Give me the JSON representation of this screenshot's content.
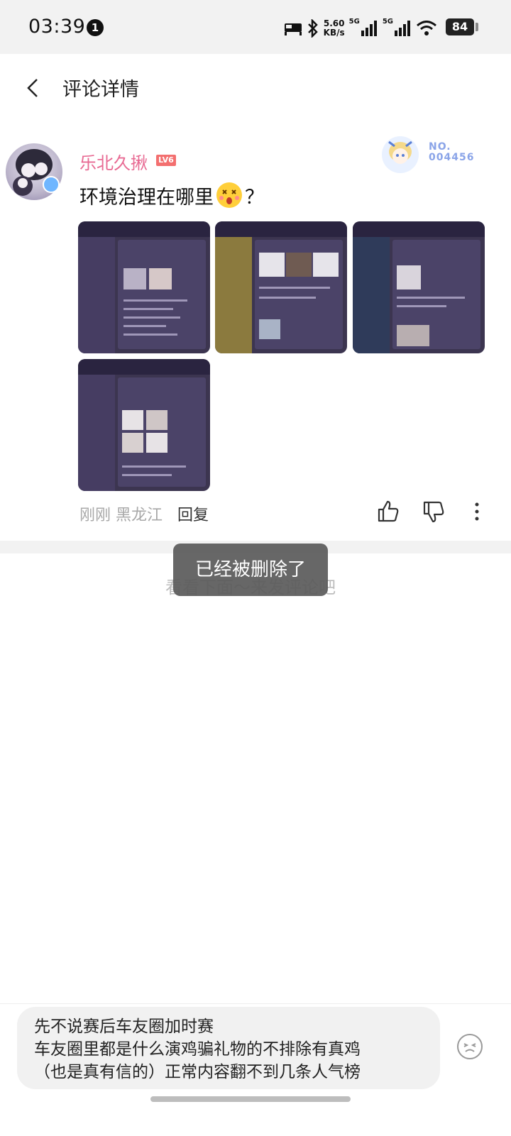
{
  "status_bar": {
    "time": "03:39",
    "notification_count": "1",
    "net_speed": "5.60\nKB/s",
    "sim1": "5G",
    "sim2": "5G",
    "battery": "84"
  },
  "header": {
    "title": "评论详情"
  },
  "comment": {
    "username": "乐北久揪",
    "level": "LV6",
    "number_badge": "NO.\n004456",
    "text_before_emoji": "环境治理在哪里",
    "text_after_emoji": "？",
    "time": "刚刚",
    "location": "黑龙江",
    "reply_label": "回复",
    "images": [
      "screenshot-1",
      "screenshot-2",
      "screenshot-3",
      "screenshot-4"
    ]
  },
  "empty_hint": "看看下面～来发评论吧",
  "toast": "已经被删除了",
  "reply_input": {
    "value": "先不说赛后车友圈加时赛\n车友圈里都是什么演鸡骗礼物的不排除有真鸡\n（也是真有信的）正常内容翻不到几条人气榜"
  },
  "colors": {
    "username": "#e86a93",
    "level_badge": "#f36f6f",
    "toast_bg": "#5a5a5a"
  }
}
